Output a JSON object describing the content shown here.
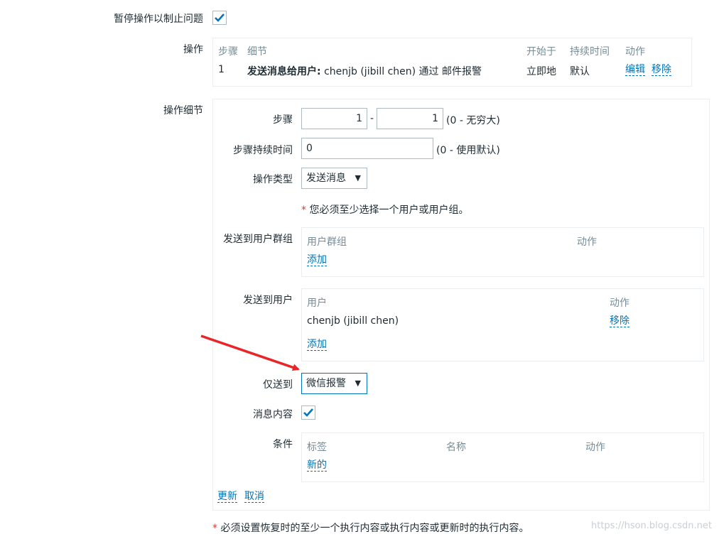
{
  "pause_label": "暂停操作以制止问题",
  "ops": {
    "label": "操作",
    "headers": {
      "step": "步骤",
      "detail": "细节",
      "start": "开始于",
      "duration": "持续时间",
      "action": "动作"
    },
    "row": {
      "step": "1",
      "detail_bold": "发送消息给用户:",
      "detail_text": "chenjb (jibill chen) 通过 邮件报警",
      "start": "立即地",
      "duration": "默认",
      "edit": "编辑",
      "remove": "移除"
    }
  },
  "details": {
    "label": "操作细节",
    "step_label": "步骤",
    "step_from": "1",
    "step_dash": "-",
    "step_to": "1",
    "step_hint": "(0 - 无穷大)",
    "step_duration_label": "步骤持续时间",
    "step_duration_value": "0",
    "step_duration_hint": "(0 - 使用默认)",
    "op_type_label": "操作类型",
    "op_type_value": "发送消息",
    "required_note": "您必须至少选择一个用户或用户组。",
    "user_groups": {
      "label": "发送到用户群组",
      "col1": "用户群组",
      "col2": "动作",
      "add": "添加"
    },
    "users": {
      "label": "发送到用户",
      "col1": "用户",
      "col2": "动作",
      "row_user": "chenjb (jibill chen)",
      "row_remove": "移除",
      "add": "添加"
    },
    "send_only_label": "仅送到",
    "send_only_value": "微信报警",
    "message_label": "消息内容",
    "conditions": {
      "label": "条件",
      "col1": "标签",
      "col2": "名称",
      "col3": "动作",
      "new": "新的"
    },
    "update": "更新",
    "cancel": "取消"
  },
  "footer_note": "必须设置恢复时的至少一个执行内容或执行内容或更新时的执行内容。",
  "required_star": "*",
  "watermark": "https://hson.blog.csdn.net",
  "colors": {
    "link": "#0275b8",
    "check": "#0275b8",
    "arrow": "#e8262a",
    "required": "#e33734"
  }
}
